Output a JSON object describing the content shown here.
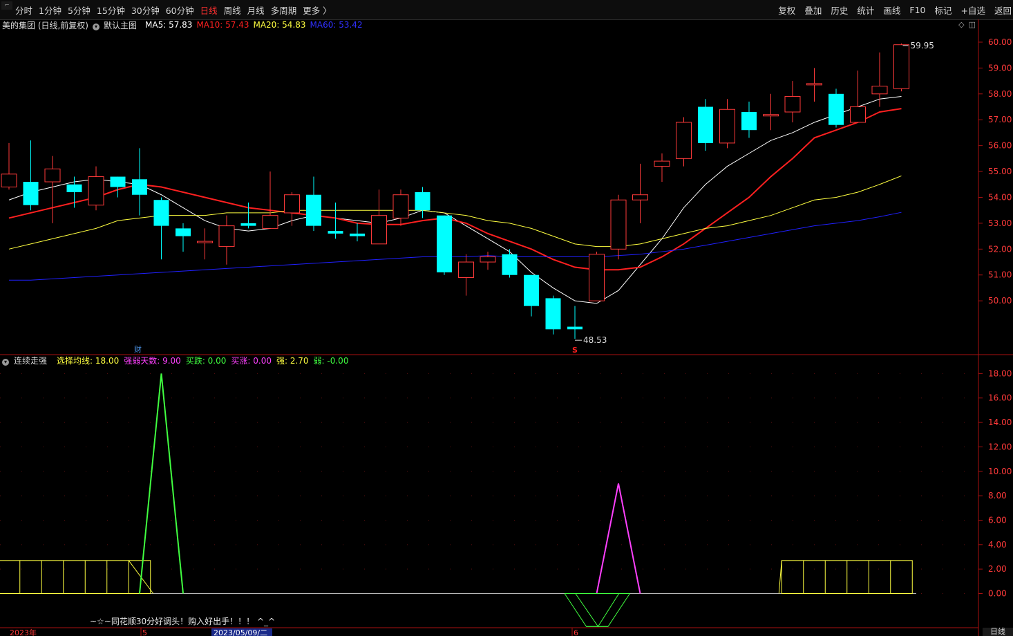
{
  "toolbar": {
    "corner": "\u0001",
    "tabs": [
      {
        "label": "分时",
        "active": false
      },
      {
        "label": "1分钟",
        "active": false
      },
      {
        "label": "5分钟",
        "active": false
      },
      {
        "label": "15分钟",
        "active": false
      },
      {
        "label": "30分钟",
        "active": false
      },
      {
        "label": "60分钟",
        "active": false
      },
      {
        "label": "日线",
        "active": true
      },
      {
        "label": "周线",
        "active": false
      },
      {
        "label": "月线",
        "active": false
      },
      {
        "label": "多周期",
        "active": false
      },
      {
        "label": "更多 〉",
        "active": false
      }
    ],
    "tools": [
      "复权",
      "叠加",
      "历史",
      "统计",
      "画线",
      "F10",
      "标记",
      "+自选",
      "返回"
    ]
  },
  "main_info": {
    "stock": "美的集团 (日线,前复权)",
    "template": "默认主图",
    "ma5": "MA5: 57.83",
    "ma10": "MA10: 57.43",
    "ma20": "MA20: 54.83",
    "ma60": "MA60: 53.42",
    "colors": {
      "ma5": "#ffffff",
      "ma10": "#ff2020",
      "ma20": "#ffff40",
      "ma60": "#2020ff"
    }
  },
  "indicator_info": {
    "name": "连续走强",
    "p1": "选择均线: 18.00",
    "p2": "强弱天数: 9.00",
    "p3": "买跌: 0.00",
    "p4": "买涨: 0.00",
    "p5": "强: 2.70",
    "p6": "弱: -0.00",
    "colors": {
      "p1": "#ffff40",
      "p2": "#ff40ff",
      "p3": "#40ff40",
      "p4": "#ff40ff",
      "p5": "#ffff40",
      "p6": "#40ff40"
    }
  },
  "annotations": {
    "high_label": "59.95",
    "low_label": "48.53",
    "fin_marker": "财",
    "s_marker": "S",
    "promo_text": "~☆~同花顺30分好调头！购入好出手！！！ ^_^",
    "bottom_tab": "日线"
  },
  "date_axis": {
    "labels": [
      "2023年",
      "5",
      "2023/05/09/二",
      "6"
    ]
  },
  "chart_data": [
    {
      "type": "candlestick",
      "title": "美的集团 (日线,前复权)",
      "ylim": [
        48.0,
        60.4
      ],
      "yticks": [
        "60.00",
        "59.00",
        "58.00",
        "57.00",
        "56.00",
        "55.00",
        "54.00",
        "53.00",
        "52.00",
        "51.00",
        "50.00"
      ],
      "ytick_values": [
        60,
        59,
        58,
        57,
        56,
        55,
        54,
        53,
        52,
        51,
        50
      ],
      "candles": [
        {
          "o": 54.4,
          "c": 54.9,
          "h": 56.1,
          "l": 54.3
        },
        {
          "o": 54.6,
          "c": 53.7,
          "h": 56.2,
          "l": 53.5
        },
        {
          "o": 54.6,
          "c": 55.1,
          "h": 55.6,
          "l": 53.0
        },
        {
          "o": 54.5,
          "c": 54.2,
          "h": 54.8,
          "l": 53.6
        },
        {
          "o": 53.7,
          "c": 54.8,
          "h": 55.2,
          "l": 53.5
        },
        {
          "o": 54.8,
          "c": 54.4,
          "h": 54.8,
          "l": 54.0
        },
        {
          "o": 54.7,
          "c": 54.1,
          "h": 55.9,
          "l": 53.3
        },
        {
          "o": 53.9,
          "c": 52.9,
          "h": 54.0,
          "l": 51.6
        },
        {
          "o": 52.8,
          "c": 52.5,
          "h": 53.0,
          "l": 51.9
        },
        {
          "o": 52.3,
          "c": 52.3,
          "h": 52.8,
          "l": 51.6
        },
        {
          "o": 52.1,
          "c": 52.9,
          "h": 53.3,
          "l": 51.4
        },
        {
          "o": 53.0,
          "c": 52.9,
          "h": 53.8,
          "l": 52.8
        },
        {
          "o": 52.8,
          "c": 53.3,
          "h": 55.0,
          "l": 52.8
        },
        {
          "o": 53.4,
          "c": 54.1,
          "h": 54.2,
          "l": 52.9
        },
        {
          "o": 54.1,
          "c": 52.9,
          "h": 54.8,
          "l": 52.7
        },
        {
          "o": 52.7,
          "c": 52.6,
          "h": 53.8,
          "l": 52.4
        },
        {
          "o": 52.6,
          "c": 52.5,
          "h": 53.0,
          "l": 52.3
        },
        {
          "o": 52.2,
          "c": 53.3,
          "h": 54.3,
          "l": 52.2
        },
        {
          "o": 53.2,
          "c": 54.1,
          "h": 54.3,
          "l": 52.9
        },
        {
          "o": 54.2,
          "c": 53.5,
          "h": 54.4,
          "l": 53.2
        },
        {
          "o": 53.3,
          "c": 51.1,
          "h": 53.3,
          "l": 51.0
        },
        {
          "o": 50.9,
          "c": 51.5,
          "h": 51.8,
          "l": 50.2
        },
        {
          "o": 51.5,
          "c": 51.7,
          "h": 51.9,
          "l": 51.2
        },
        {
          "o": 51.8,
          "c": 51.0,
          "h": 52.0,
          "l": 50.9
        },
        {
          "o": 51.0,
          "c": 49.8,
          "h": 51.0,
          "l": 49.4
        },
        {
          "o": 50.1,
          "c": 48.9,
          "h": 50.2,
          "l": 48.7
        },
        {
          "o": 49.0,
          "c": 48.9,
          "h": 49.8,
          "l": 48.53
        },
        {
          "o": 50.0,
          "c": 51.8,
          "h": 51.9,
          "l": 50.0
        },
        {
          "o": 52.0,
          "c": 53.9,
          "h": 54.1,
          "l": 51.6
        },
        {
          "o": 53.9,
          "c": 54.1,
          "h": 55.3,
          "l": 53.0
        },
        {
          "o": 55.2,
          "c": 55.4,
          "h": 55.7,
          "l": 54.6
        },
        {
          "o": 55.5,
          "c": 56.9,
          "h": 57.1,
          "l": 55.2
        },
        {
          "o": 57.5,
          "c": 56.1,
          "h": 57.8,
          "l": 55.8
        },
        {
          "o": 56.1,
          "c": 57.4,
          "h": 57.8,
          "l": 55.9
        },
        {
          "o": 57.3,
          "c": 56.6,
          "h": 57.7,
          "l": 56.3
        },
        {
          "o": 57.2,
          "c": 57.2,
          "h": 58.0,
          "l": 56.6
        },
        {
          "o": 57.3,
          "c": 57.9,
          "h": 58.5,
          "l": 56.9
        },
        {
          "o": 58.4,
          "c": 58.4,
          "h": 59.0,
          "l": 57.7
        },
        {
          "o": 58.0,
          "c": 56.8,
          "h": 58.2,
          "l": 56.7
        },
        {
          "o": 56.9,
          "c": 57.5,
          "h": 58.9,
          "l": 56.9
        },
        {
          "o": 58.0,
          "c": 58.3,
          "h": 59.6,
          "l": 57.5
        },
        {
          "o": 58.2,
          "c": 59.9,
          "h": 59.95,
          "l": 58.1
        }
      ],
      "series": [
        {
          "name": "MA5",
          "color": "#ffffff",
          "values": [
            53.9,
            54.2,
            54.4,
            54.6,
            54.7,
            54.6,
            54.5,
            54.1,
            53.6,
            53.1,
            52.8,
            52.7,
            52.8,
            53.1,
            53.3,
            53.2,
            53.1,
            53.0,
            53.2,
            53.5,
            53.4,
            52.9,
            52.4,
            51.9,
            51.1,
            50.5,
            50.0,
            49.9,
            50.4,
            51.4,
            52.4,
            53.6,
            54.5,
            55.2,
            55.7,
            56.2,
            56.5,
            56.9,
            57.2,
            57.5,
            57.8,
            57.9
          ]
        },
        {
          "name": "MA10",
          "color": "#ff2020",
          "values": [
            53.2,
            53.4,
            53.6,
            53.8,
            54.0,
            54.3,
            54.5,
            54.4,
            54.2,
            54.0,
            53.8,
            53.6,
            53.5,
            53.4,
            53.3,
            53.2,
            53.0,
            52.95,
            52.95,
            53.1,
            53.2,
            53.0,
            52.6,
            52.3,
            52.0,
            51.6,
            51.3,
            51.2,
            51.2,
            51.3,
            51.7,
            52.2,
            52.8,
            53.4,
            54.0,
            54.8,
            55.5,
            56.3,
            56.6,
            56.9,
            57.3,
            57.43
          ]
        },
        {
          "name": "MA20",
          "color": "#ffff40",
          "values": [
            52.0,
            52.2,
            52.4,
            52.6,
            52.8,
            53.1,
            53.2,
            53.3,
            53.3,
            53.3,
            53.4,
            53.4,
            53.4,
            53.5,
            53.5,
            53.5,
            53.5,
            53.5,
            53.5,
            53.5,
            53.4,
            53.3,
            53.1,
            53.0,
            52.8,
            52.5,
            52.2,
            52.1,
            52.1,
            52.2,
            52.4,
            52.6,
            52.8,
            52.9,
            53.1,
            53.3,
            53.6,
            53.9,
            54.0,
            54.2,
            54.5,
            54.83
          ]
        },
        {
          "name": "MA60",
          "color": "#2020ff",
          "values": [
            50.8,
            50.8,
            50.85,
            50.9,
            50.95,
            51.0,
            51.05,
            51.1,
            51.15,
            51.2,
            51.25,
            51.3,
            51.35,
            51.4,
            51.45,
            51.5,
            51.55,
            51.6,
            51.65,
            51.7,
            51.7,
            51.7,
            51.75,
            51.7,
            51.7,
            51.7,
            51.7,
            51.7,
            51.75,
            51.8,
            51.9,
            52.0,
            52.15,
            52.3,
            52.45,
            52.6,
            52.75,
            52.9,
            53.0,
            53.1,
            53.25,
            53.42
          ]
        }
      ]
    },
    {
      "type": "line",
      "title": "连续走强",
      "ylim": [
        -2.8,
        18.7
      ],
      "yticks": [
        "18.00",
        "16.00",
        "14.00",
        "12.00",
        "10.00",
        "8.00",
        "6.00",
        "4.00",
        "2.00",
        "0.00"
      ],
      "ytick_values": [
        18,
        16,
        14,
        12,
        10,
        8,
        6,
        4,
        2,
        0
      ],
      "series": [
        {
          "name": "强",
          "color": "#ffff40",
          "style": "stick-box",
          "ranges": [
            [
              0,
              6
            ],
            [
              36,
              41
            ]
          ],
          "value": 2.7
        },
        {
          "name": "买跌",
          "color": "#40ff40",
          "points": [
            [
              6,
              0
            ],
            [
              7,
              18
            ],
            [
              8,
              0
            ]
          ]
        },
        {
          "name": "买涨",
          "color": "#ff40ff",
          "points": [
            [
              27,
              0
            ],
            [
              28,
              9
            ],
            [
              29,
              0
            ]
          ]
        },
        {
          "name": "弱",
          "color": "#40ff40",
          "style": "trap",
          "points": [
            [
              26,
              0
            ],
            [
              27,
              -2.7
            ],
            [
              28,
              -2.7
            ],
            [
              29,
              0
            ]
          ]
        }
      ]
    }
  ]
}
